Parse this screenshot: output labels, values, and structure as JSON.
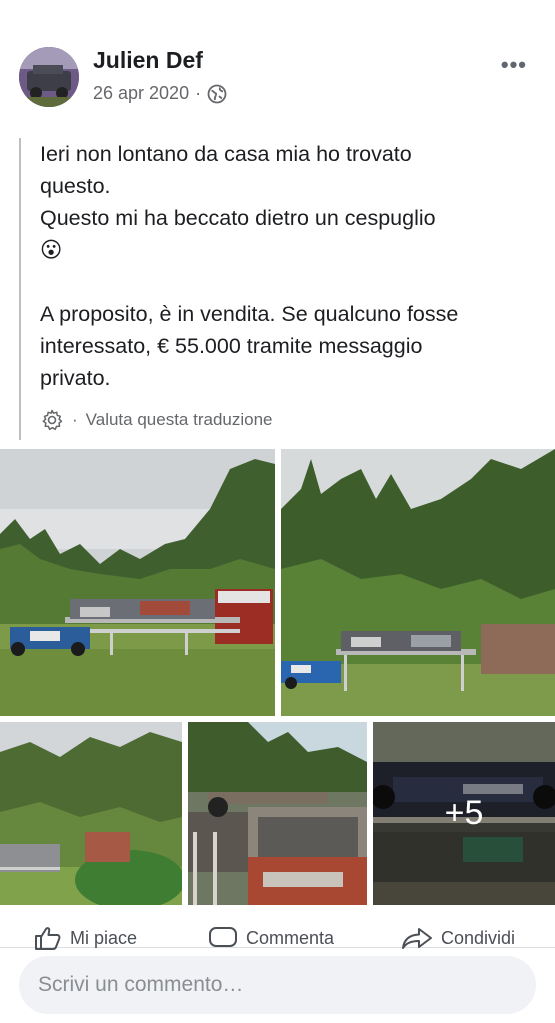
{
  "post": {
    "author": "Julien Def",
    "date": "26 apr 2020",
    "separator": "·",
    "text": "Ieri non lontano da casa mia ho trovato\nquesto.\nQuesto mi ha beccato dietro un cespuglio\n😮\n\nA proposito, è in vendita. Se qualcuno fosse\ninteressato, € 55.000 tramite messaggio\nprivato.",
    "translation_separator": "·",
    "translation_label": "Valuta questa traduzione",
    "more_photos_label": "+5"
  },
  "actions": {
    "like_label": "Mi piace",
    "comment_label": "Commenta",
    "share_label": "Condividi"
  },
  "comment": {
    "placeholder": "Scrivi un commento…"
  },
  "icons": {
    "audience": "globe-icon",
    "more": "more-options-icon",
    "settings": "gear-icon",
    "like": "thumbs-up-icon",
    "comment": "speech-bubble-icon",
    "share": "share-arrow-icon"
  }
}
